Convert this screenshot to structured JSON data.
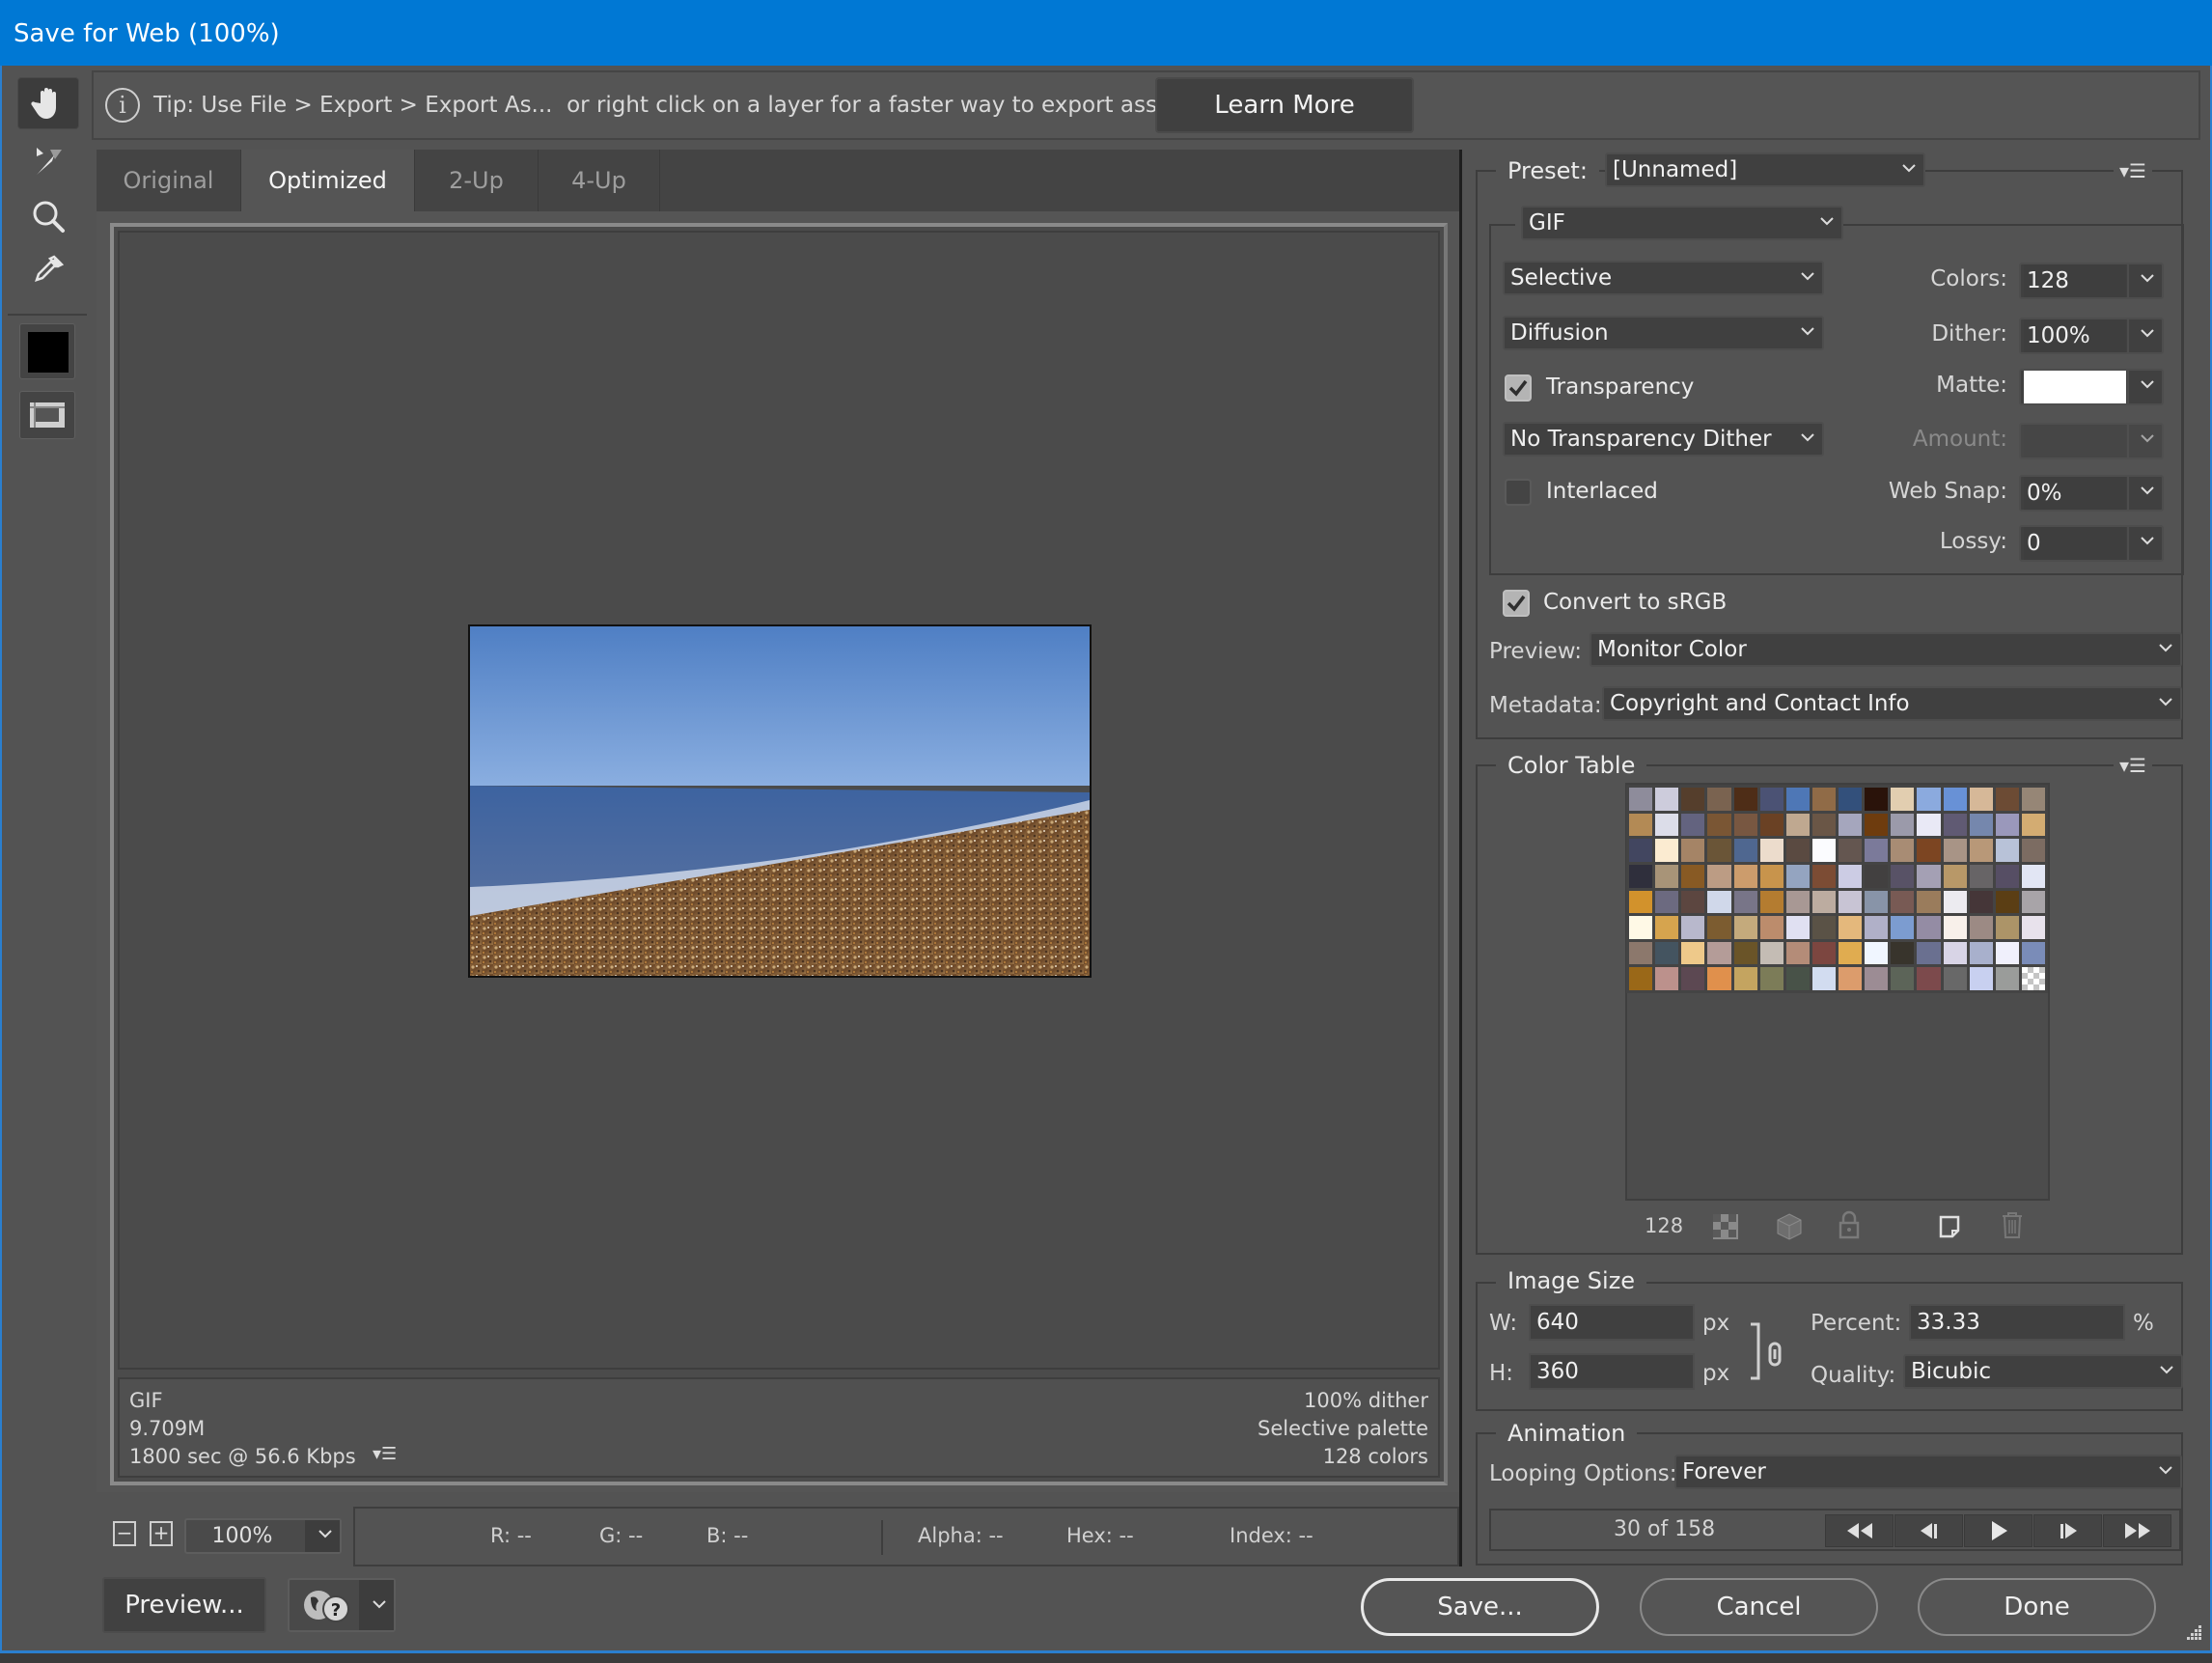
{
  "window": {
    "title": "Save for Web (100%)"
  },
  "toolbar": {
    "tools": [
      {
        "name": "hand-tool",
        "icon": "hand-icon",
        "active": true
      },
      {
        "name": "slice-select-tool",
        "icon": "slice-select-icon",
        "active": false
      },
      {
        "name": "zoom-tool",
        "icon": "magnifier-icon",
        "active": false
      },
      {
        "name": "eyedropper-tool",
        "icon": "eyedropper-icon",
        "active": false
      }
    ],
    "eyedropper_color": "#000000",
    "toggle_slices_icon": "slice-visibility-icon"
  },
  "tip": {
    "icon": "info-icon",
    "text": "Tip: Use File > Export > Export As...  or right click on a layer for a faster way to export assets",
    "learn_more": "Learn More"
  },
  "tabs": [
    {
      "label": "Original",
      "active": false
    },
    {
      "label": "Optimized",
      "active": true
    },
    {
      "label": "2-Up",
      "active": false
    },
    {
      "label": "4-Up",
      "active": false
    }
  ],
  "preview": {
    "image_description": "Pebble beach with sea waves under a clear blue sky",
    "info_left": [
      "GIF",
      "9.709M",
      "1800 sec @ 56.6 Kbps"
    ],
    "info_right": [
      "100% dither",
      "Selective palette",
      "128 colors"
    ],
    "info_menu_icon": "panel-menu-icon"
  },
  "zoom": {
    "minus": "−",
    "plus": "+",
    "value": "100%"
  },
  "pixel_info": {
    "r": "R: --",
    "g": "G: --",
    "b": "B: --",
    "alpha": "Alpha: --",
    "hex": "Hex: --",
    "index": "Index: --"
  },
  "bottom_buttons": {
    "preview": "Preview...",
    "browser_icon": "browser-globe-help-icon",
    "save": "Save...",
    "cancel": "Cancel",
    "done": "Done"
  },
  "settings": {
    "preset_label": "Preset:",
    "preset_value": "[Unnamed]",
    "format": "GIF",
    "reduction": "Selective",
    "dither_algorithm": "Diffusion",
    "transparency_label": "Transparency",
    "transparency_checked": true,
    "transparency_dither": "No Transparency Dither",
    "interlaced_label": "Interlaced",
    "interlaced_checked": false,
    "colors_label": "Colors:",
    "colors_value": "128",
    "dither_label": "Dither:",
    "dither_value": "100%",
    "matte_label": "Matte:",
    "matte_color": "#ffffff",
    "amount_label": "Amount:",
    "amount_value": "",
    "websnap_label": "Web Snap:",
    "websnap_value": "0%",
    "lossy_label": "Lossy:",
    "lossy_value": "0",
    "convert_srgb_label": "Convert to sRGB",
    "convert_srgb_checked": true,
    "preview_label": "Preview:",
    "preview_value": "Monitor Color",
    "metadata_label": "Metadata:",
    "metadata_value": "Copyright and Contact Info"
  },
  "color_table": {
    "title": "Color Table",
    "count": "128",
    "footer_icons": [
      "transparency-map-icon",
      "web-shift-icon",
      "lock-color-icon",
      "new-color-icon",
      "delete-color-icon"
    ],
    "colors": [
      "#8e8c9b",
      "#cdccdc",
      "#553e2c",
      "#7a6350",
      "#4e2d17",
      "#4b5274",
      "#4e77b6",
      "#906b47",
      "#33507b",
      "#2a130a",
      "#e2ceb0",
      "#8baade",
      "#6891d6",
      "#d6b898",
      "#6c4b34",
      "#968676",
      "#b38a55",
      "#dcdde9",
      "#63637f",
      "#7a5634",
      "#785741",
      "#6a4124",
      "#bfa890",
      "#6a5646",
      "#a5a6bd",
      "#6e3c0e",
      "#9b9aaa",
      "#e9e9f6",
      "#605a73",
      "#7587ad",
      "#9a98bb",
      "#d3ac72",
      "#424660",
      "#fbebd1",
      "#a58466",
      "#6a5537",
      "#4f6790",
      "#ecdccc",
      "#5a4a41",
      "#fbfcff",
      "#645650",
      "#7b7a9a",
      "#a88c74",
      "#7c4522",
      "#a89486",
      "#b89878",
      "#b8c2d8",
      "#7c6c62",
      "#2f2f3c",
      "#a89478",
      "#885a24",
      "#bc9c84",
      "#cc9c6c",
      "#c8944c",
      "#94a4c0",
      "#7c4c34",
      "#cccce4",
      "#424040",
      "#585266",
      "#a4a0b4",
      "#b89868",
      "#676466",
      "#564e64",
      "#e2e6f4",
      "#d2922c",
      "#6c6a80",
      "#5c4640",
      "#d0d8ea",
      "#787588",
      "#b47c30",
      "#a89894",
      "#bcaca0",
      "#c8c4d4",
      "#8894a8",
      "#785a54",
      "#9a7c5c",
      "#ecebf0",
      "#453638",
      "#5b3e14",
      "#a8a4a8",
      "#fff9e6",
      "#d6a44e",
      "#b8b8cc",
      "#7c5c30",
      "#c4aa7c",
      "#bc8c6c",
      "#e0e0f2",
      "#5a5246",
      "#e4b87c",
      "#b0b0c8",
      "#7c9cd0",
      "#948ca4",
      "#f8f0ea",
      "#9c8a84",
      "#ac9468",
      "#e8e2ec",
      "#8c786c",
      "#445460",
      "#eec98a",
      "#b49c98",
      "#6a5428",
      "#c4bcb4",
      "#b48c78",
      "#7c4640",
      "#e0ac50",
      "#f0f6ff",
      "#38342c",
      "#6a7090",
      "#d8d4e6",
      "#a8b0cc",
      "#f0f0fc",
      "#7a8cb8",
      "#9a6818",
      "#bc918c",
      "#5c4852",
      "#e0904c",
      "#c4a460",
      "#7c7c58",
      "#485248",
      "#d2dcf0",
      "#dc9c6c",
      "#9c8c94",
      "#5c6458",
      "#7c4a4c",
      "#686868",
      "#c8d0f0",
      "#9a9c9a",
      "transparent"
    ]
  },
  "image_size": {
    "title": "Image Size",
    "w_label": "W:",
    "w_value": "640",
    "h_label": "H:",
    "h_value": "360",
    "unit": "px",
    "percent_label": "Percent:",
    "percent_value": "33.33",
    "percent_unit": "%",
    "quality_label": "Quality:",
    "quality_value": "Bicubic",
    "link_icon": "chain-link-icon"
  },
  "animation": {
    "title": "Animation",
    "looping_label": "Looping Options:",
    "looping_value": "Forever",
    "frame_text": "30 of 158",
    "current_frame": 30,
    "total_frames": 158,
    "controls": [
      "first-frame-icon",
      "previous-frame-icon",
      "play-icon",
      "next-frame-icon",
      "last-frame-icon"
    ]
  }
}
